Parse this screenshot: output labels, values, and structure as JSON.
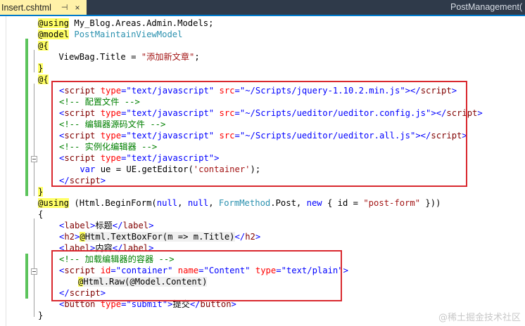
{
  "tabs": {
    "active": "Insert.cshtml",
    "pin_glyph": "⊣",
    "close_glyph": "×",
    "other": "PostManagement("
  },
  "code": {
    "l1": {
      "kw": "@using",
      "rest": " My_Blog.Areas.Admin.Models;"
    },
    "l2": {
      "kw": "@model",
      "type": "PostMaintainViewModel"
    },
    "l3": {
      "text": "@{"
    },
    "l4": {
      "pre": "    ViewBag.Title = ",
      "str": "\"添加新文章\"",
      "post": ";"
    },
    "l5": {
      "text": "}"
    },
    "l6": {
      "text": "@{"
    },
    "l7": {
      "tag_open": "<",
      "tag": "script",
      "a1": " type",
      "eq1": "=",
      "v1": "\"text/javascript\"",
      "a2": " src",
      "eq2": "=",
      "v2": "\"~/Scripts/jquery-1.10.2.min.js\"",
      "close": "></",
      "tag2": "script",
      "end": ">"
    },
    "l8": {
      "text": "<!-- 配置文件 -->"
    },
    "l9": {
      "tag_open": "<",
      "tag": "script",
      "a1": " type",
      "eq1": "=",
      "v1": "\"text/javascript\"",
      "a2": " src",
      "eq2": "=",
      "v2": "\"~/Scripts/ueditor/ueditor.config.js\"",
      "close": "></",
      "tag2": "script",
      "end": ">"
    },
    "l10": {
      "text": "<!-- 编辑器源码文件 -->"
    },
    "l11": {
      "tag_open": "<",
      "tag": "script",
      "a1": " type",
      "eq1": "=",
      "v1": "\"text/javascript\"",
      "a2": " src",
      "eq2": "=",
      "v2": "\"~/Scripts/ueditor/ueditor.all.js\"",
      "close": "></",
      "tag2": "script",
      "end": ">"
    },
    "l12": {
      "text": "<!-- 实例化编辑器 -->"
    },
    "l13": {
      "tag_open": "<",
      "tag": "script",
      "a1": " type",
      "eq1": "=",
      "v1": "\"text/javascript\"",
      "end": ">"
    },
    "l14": {
      "kw": "    var",
      "rest": " ue = UE.getEditor(",
      "str": "'container'",
      "post": ");"
    },
    "l15": {
      "open": "</",
      "tag": "script",
      "end": ">"
    },
    "l16": {
      "text": "}"
    },
    "l17": {
      "kw": "@using",
      "p1": " (Html.BeginForm(",
      "k2": "null",
      "p2": ", ",
      "k3": "null",
      "p3": ", ",
      "t1": "FormMethod",
      "p4": ".Post, ",
      "k4": "new",
      "p5": " { id = ",
      "s1": "\"post-form\"",
      "p6": " }))"
    },
    "l18": {
      "text": "{"
    },
    "l19": {
      "o1": "<",
      "t1": "label",
      "c1": ">",
      "txt": "标题",
      "o2": "</",
      "t2": "label",
      "c2": ">"
    },
    "l20": {
      "o1": "<",
      "t1": "h2",
      "c1": ">",
      "at": "@",
      "expr": "Html.TextBoxFor(m => m.Title)",
      "o2": "</",
      "t2": "h2",
      "c2": ">"
    },
    "l21": {
      "o1": "<",
      "t1": "label",
      "c1": ">",
      "txt": "内容",
      "o2": "</",
      "t2": "label",
      "c2": ">"
    },
    "l22": {
      "text": "<!-- 加载编辑器的容器 -->"
    },
    "l23": {
      "o1": "<",
      "t1": "script",
      "a1": " id",
      "e1": "=",
      "v1": "\"container\"",
      "a2": " name",
      "e2": "=",
      "v2": "\"Content\"",
      "a3": " type",
      "e3": "=",
      "v3": "\"text/plain\"",
      "c1": ">"
    },
    "l24": {
      "at": "@",
      "expr": "Html.Raw(@Model.Content)"
    },
    "l25": {
      "o1": "</",
      "t1": "script",
      "c1": ">"
    },
    "l26": {
      "o1": "<",
      "t1": "button",
      "a1": " type",
      "e1": "=",
      "v1": "\"submit\"",
      "c1": ">",
      "txt": "提交",
      "o2": "</",
      "t2": "button",
      "c2": ">"
    },
    "l27": {
      "text": "}"
    }
  },
  "watermark": "@稀土掘金技术社区",
  "colors": {
    "tab_active_bg": "#fff1a8",
    "tabbar_bg": "#2f3a4a",
    "keyword": "#0000ff",
    "type": "#2b91af",
    "string": "#a31515",
    "comment": "#008000",
    "tag": "#800000",
    "attribute": "#ff0000",
    "razor_highlight": "#ffff66",
    "change_bar": "#5cc45c",
    "annotation_box": "#d9282e"
  }
}
